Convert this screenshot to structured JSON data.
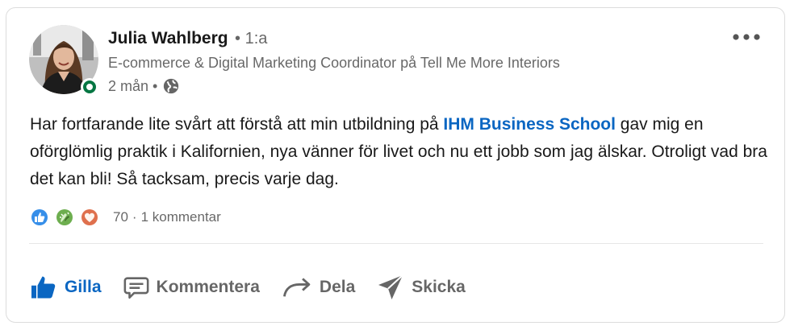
{
  "post": {
    "author": {
      "name": "Julia Wahlberg",
      "degree": "• 1:a",
      "headline": "E-commerce & Digital Marketing Coordinator på Tell Me More Interiors",
      "time": "2 mån •",
      "visibility_icon": "globe-icon",
      "status": "online"
    },
    "text": {
      "before_link": "Har fortfarande lite svårt att förstå att min utbildning på ",
      "link": "IHM Business School",
      "after_link": " gav mig en oförglömlig praktik i Kalifornien, nya vänner för livet och nu ett jobb som jag älskar. Otroligt vad bra det kan bli! Så tacksam, precis varje dag."
    },
    "social": {
      "reaction_icons": [
        "like-reaction-icon",
        "celebrate-reaction-icon",
        "love-reaction-icon"
      ],
      "reaction_count": "70",
      "separator": "·",
      "comments": "1 kommentar"
    },
    "actions": {
      "like": "Gilla",
      "comment": "Kommentera",
      "share": "Dela",
      "send": "Skicka"
    },
    "more_icon": "more-horizontal-icon"
  },
  "colors": {
    "link": "#0a66c2",
    "online": "#057642",
    "like_reaction": "#378fe9",
    "celebrate_reaction": "#44712e",
    "love_reaction": "#df704d"
  }
}
